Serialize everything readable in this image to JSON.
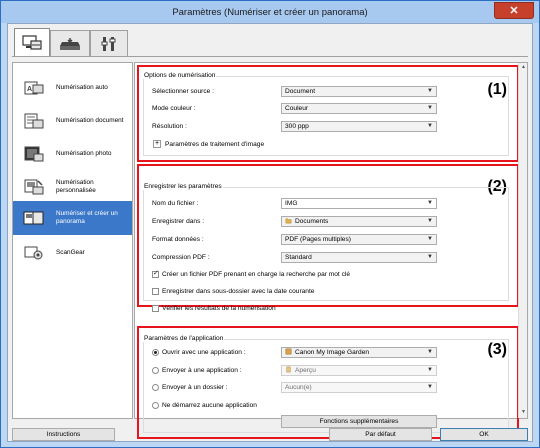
{
  "window": {
    "title": "Paramètres (Numériser et créer un panorama)",
    "close": "✕"
  },
  "tabs": [
    {
      "icon": "scan-settings-icon"
    },
    {
      "icon": "scanner-icon"
    },
    {
      "icon": "tools-icon"
    }
  ],
  "sidebar": {
    "items": [
      {
        "label": "Numérisation auto",
        "icon": "auto-scan-icon"
      },
      {
        "label": "Numérisation document",
        "icon": "document-scan-icon"
      },
      {
        "label": "Numérisation photo",
        "icon": "photo-scan-icon"
      },
      {
        "label": "Numérisation personnalisée",
        "icon": "custom-scan-icon"
      },
      {
        "label": "Numériser et créer un panorama",
        "icon": "stitch-scan-icon",
        "selected": true
      },
      {
        "label": "ScanGear",
        "icon": "scangear-icon"
      }
    ]
  },
  "sections": {
    "scan": {
      "number": "(1)",
      "title": "Options de numérisation",
      "source_label": "Sélectionner source :",
      "source_value": "Document",
      "color_label": "Mode couleur :",
      "color_value": "Couleur",
      "res_label": "Résolution :",
      "res_value": "300 ppp",
      "image_settings_label": "Paramètres de traitement d'image",
      "expand": "+"
    },
    "save": {
      "number": "(2)",
      "title": "Enregistrer les paramètres",
      "filename_label": "Nom du fichier :",
      "filename_value": "IMG",
      "savein_label": "Enregistrer dans :",
      "savein_value": "Documents",
      "format_label": "Format données :",
      "format_value": "PDF (Pages multiples)",
      "compression_label": "Compression PDF :",
      "compression_value": "Standard",
      "check_searchable": "Créer un fichier PDF prenant en charge la recherche par mot clé",
      "check_subfolder": "Enregistrer dans sous-dossier avec la date courante",
      "check_verify": "Vérifier les résultats de la numérisation"
    },
    "app": {
      "number": "(3)",
      "title": "Paramètres de l'application",
      "opt_open": "Ouvrir avec une application :",
      "opt_open_value": "Canon My Image Garden",
      "opt_send_app": "Envoyer à une application :",
      "opt_send_app_value": "Aperçu",
      "opt_send_folder": "Envoyer à un dossier :",
      "opt_send_folder_value": "Aucun(e)",
      "opt_none": "Ne démarrez aucune application",
      "more_button": "Fonctions supplémentaires"
    }
  },
  "footer": {
    "instructions": "Instructions",
    "defaults": "Par défaut",
    "ok": "OK"
  },
  "colors": {
    "accent": "#3c78c9",
    "highlight_box": "#e8141d",
    "title_bar": "#a7c8ef"
  }
}
